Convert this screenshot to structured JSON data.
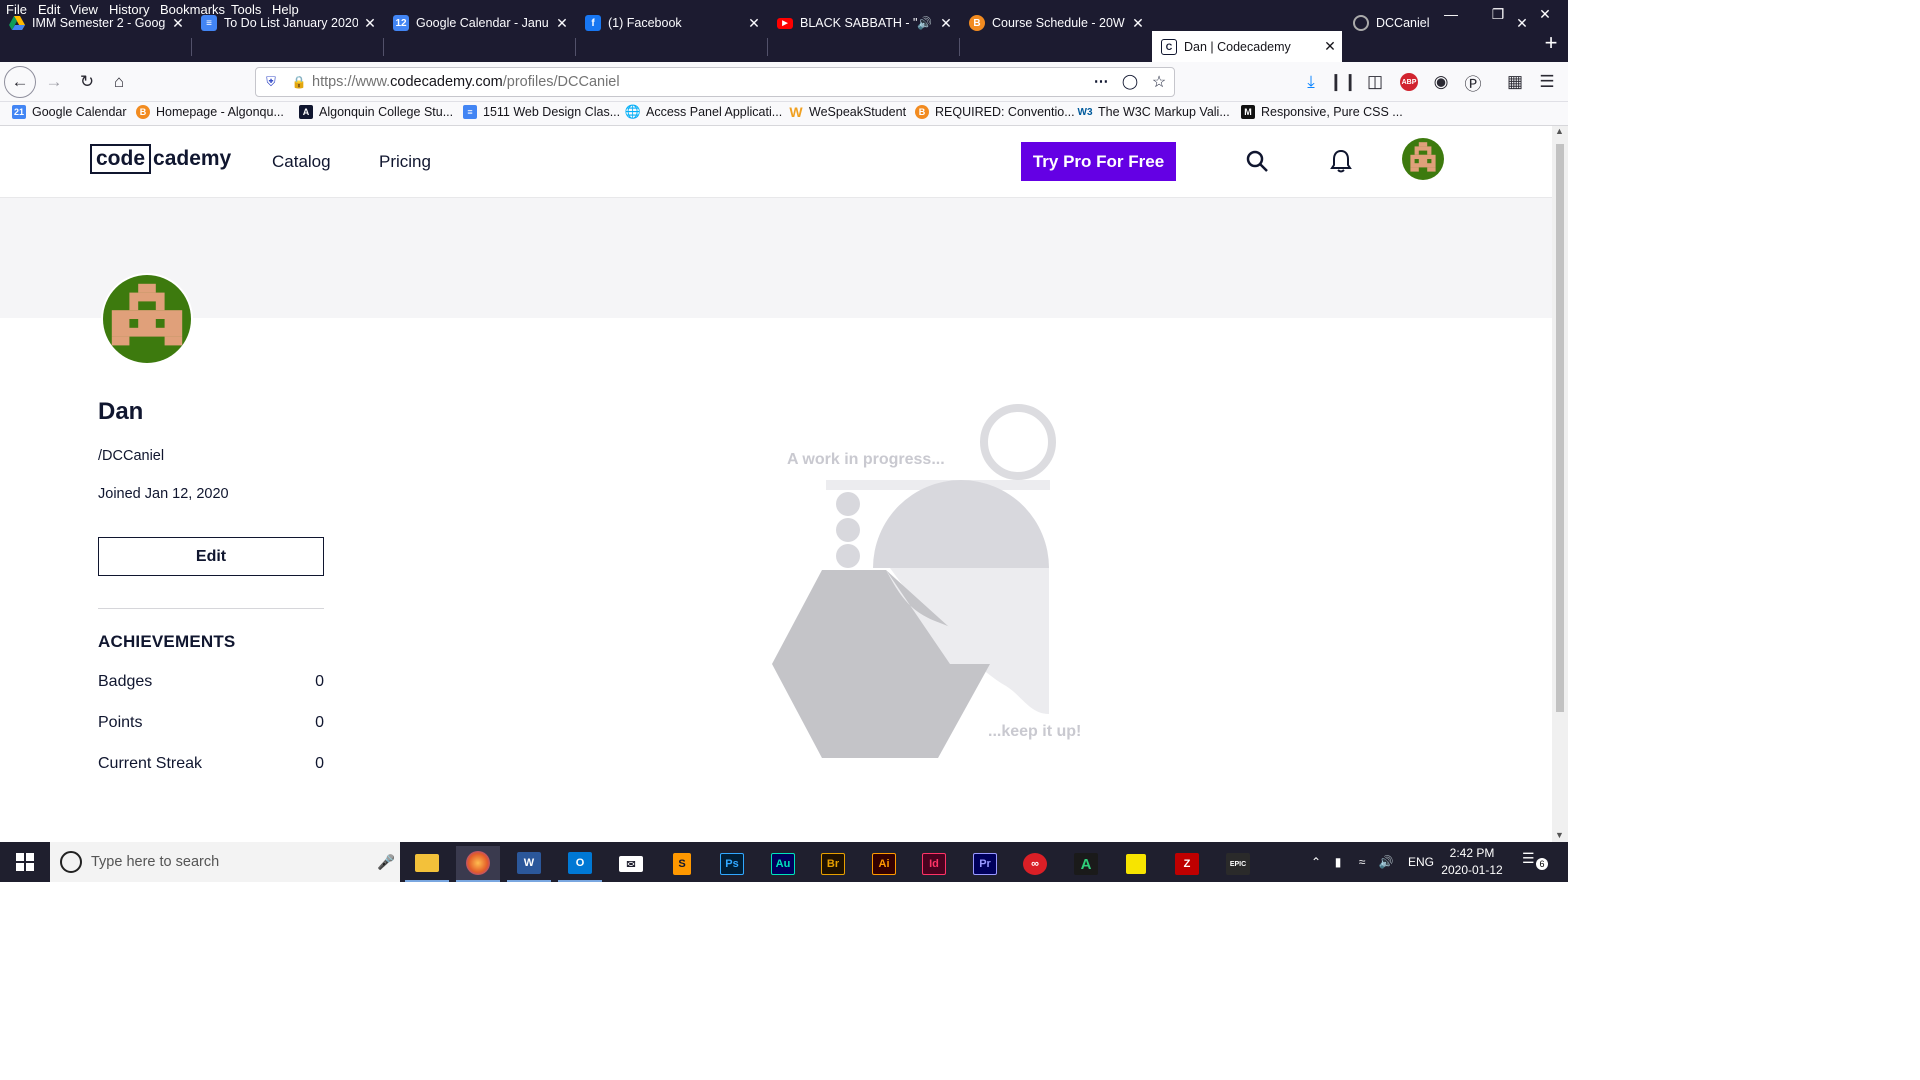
{
  "menubar": {
    "items": [
      "File",
      "Edit",
      "View",
      "History",
      "Bookmarks",
      "Tools",
      "Help"
    ]
  },
  "tabs": [
    {
      "title": "IMM Semester 2 - Goog",
      "icon": "google-drive-icon"
    },
    {
      "title": "To Do List January 2020",
      "icon": "google-docs-icon"
    },
    {
      "title": "Google Calendar - Janu",
      "icon": "google-calendar-icon"
    },
    {
      "title": "(1) Facebook",
      "icon": "facebook-icon"
    },
    {
      "title": "BLACK SABBATH - \"I",
      "icon": "youtube-icon"
    },
    {
      "title": "Course Schedule - 20W",
      "icon": "brightspace-icon"
    },
    {
      "title": "Dan | Codecademy",
      "icon": "codecademy-icon"
    },
    {
      "title": "DCCaniel",
      "icon": "github-icon"
    }
  ],
  "url": {
    "prefix": "https://www.",
    "domain": "codecademy.com",
    "path": "/profiles/DCCaniel"
  },
  "bookmarks": [
    "Google Calendar",
    "Homepage - Algonqu...",
    "Algonquin College Stu...",
    "1511 Web Design Clas...",
    "Access Panel Applicati...",
    "WeSpeakStudent",
    "REQUIRED: Conventio...",
    "The W3C Markup Vali...",
    "Responsive, Pure CSS ..."
  ],
  "site": {
    "logo_left": "code",
    "logo_right": "cademy",
    "nav": [
      "Catalog",
      "Pricing"
    ],
    "cta": "Try Pro For Free",
    "accent": "#6400e4"
  },
  "profile": {
    "name": "Dan",
    "handle": "/DCCaniel",
    "joined": "Joined Jan 12, 2020",
    "edit_label": "Edit",
    "achievements_title": "ACHIEVEMENTS",
    "achievements": [
      {
        "label": "Badges",
        "value": "0"
      },
      {
        "label": "Points",
        "value": "0"
      },
      {
        "label": "Current Streak",
        "value": "0"
      }
    ]
  },
  "wip": {
    "top": "A work in progress...",
    "bottom": "...keep it up!"
  },
  "taskbar": {
    "search_placeholder": "Type here to search",
    "apps": [
      "file-explorer-icon",
      "firefox-icon",
      "word-icon",
      "outlook-icon",
      "mail-icon",
      "sublime-icon",
      "photoshop-icon",
      "audition-icon",
      "bridge-icon",
      "illustrator-icon",
      "indesign-icon",
      "premiere-icon",
      "creative-cloud-icon",
      "acrobat-icon",
      "sticky-notes-icon",
      "filezilla-icon",
      "epic-games-icon"
    ],
    "app_labels": {
      "ps": "Ps",
      "au": "Au",
      "br": "Br",
      "ai": "Ai",
      "id": "Id",
      "pr": "Pr",
      "epic": "EPIC"
    },
    "lang": "ENG",
    "time": "2:42 PM",
    "date": "2020-01-12",
    "notifications": "6"
  }
}
